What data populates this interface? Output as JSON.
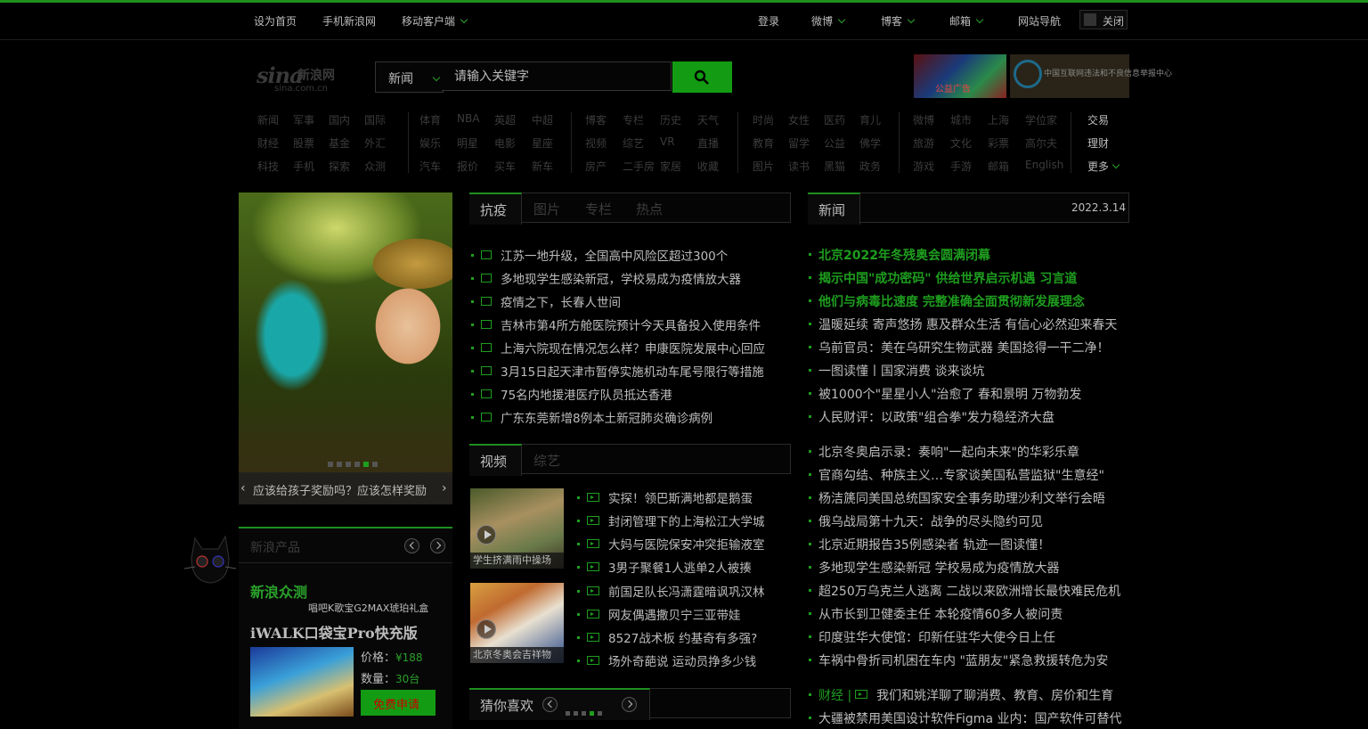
{
  "topbar": {
    "left": [
      "设为首页",
      "手机新浪网",
      "移动客户端"
    ],
    "right": [
      {
        "label": "登录",
        "dropdown": false
      },
      {
        "label": "微博",
        "dropdown": true
      },
      {
        "label": "博客",
        "dropdown": true
      },
      {
        "label": "邮箱",
        "dropdown": true
      },
      {
        "label": "网站导航",
        "dropdown": false
      }
    ],
    "close_label": "关闭"
  },
  "logo": {
    "mark": "sina",
    "cn": "新浪网",
    "domain": "sina.com.cn"
  },
  "search": {
    "category": "新闻",
    "placeholder": "请输入关键字"
  },
  "ads": {
    "ad1": "公益广告",
    "ad2": "中国互联网违法和不良信息举报中心"
  },
  "nav": [
    [
      [
        "新闻",
        "军事",
        "国内",
        "国际"
      ],
      [
        "财经",
        "股票",
        "基金",
        "外汇"
      ],
      [
        "科技",
        "手机",
        "探索",
        "众测"
      ]
    ],
    [
      [
        "体育",
        "NBA",
        "英超",
        "中超"
      ],
      [
        "娱乐",
        "明星",
        "电影",
        "星座"
      ],
      [
        "汽车",
        "报价",
        "买车",
        "新车"
      ]
    ],
    [
      [
        "博客",
        "专栏",
        "历史",
        "天气"
      ],
      [
        "视频",
        "综艺",
        "VR",
        "直播"
      ],
      [
        "房产",
        "二手房",
        "家居",
        "收藏"
      ]
    ],
    [
      [
        "时尚",
        "女性",
        "医药",
        "育儿"
      ],
      [
        "教育",
        "留学",
        "公益",
        "佛学"
      ],
      [
        "图片",
        "读书",
        "黑猫",
        "政务"
      ]
    ],
    [
      [
        "微博",
        "城市",
        "上海",
        "学位家"
      ],
      [
        "旅游",
        "文化",
        "彩票",
        "高尔夫"
      ],
      [
        "游戏",
        "手游",
        "邮箱",
        "English"
      ]
    ],
    [
      [
        "交易"
      ],
      [
        "理财"
      ],
      [
        "更多"
      ]
    ]
  ],
  "slide": {
    "caption": "应该给孩子奖励吗？应该怎样奖励",
    "dots": 6,
    "active_dot": 4
  },
  "products": {
    "title": "新浪产品",
    "brand": "新浪众测",
    "subtitle": "唱吧K歌宝G2MAX琥珀礼盒",
    "name": "iWALK口袋宝Pro快充版",
    "price_label": "价格：",
    "price": "¥188",
    "qty_label": "数量：",
    "qty": "30台",
    "apply": "免费申请"
  },
  "center": {
    "tabs": [
      "抗疫",
      "图片",
      "专栏",
      "热点"
    ],
    "news": [
      "江苏一地升级，全国高中风险区超过300个",
      "多地现学生感染新冠，学校易成为疫情放大器",
      "疫情之下，长春人世间",
      "吉林市第4所方舱医院预计今天具备投入使用条件",
      "上海六院现在情况怎么样？申康医院发展中心回应",
      "3月15日起天津市暂停实施机动车尾号限行等措施",
      "75名内地援港医疗队员抵达香港",
      "广东东莞新增8例本土新冠肺炎确诊病例"
    ],
    "video_tabs": [
      "视频",
      "综艺"
    ],
    "video_thumbs": [
      "学生挤满雨中操场",
      "北京冬奥会吉祥物"
    ],
    "video_news": [
      "实探！领巴斯满地都是鹅蛋",
      "封闭管理下的上海松江大学城",
      "大妈与医院保安冲突拒输液室",
      "3男子聚餐1人逃单2人被揍",
      "前国足队长冯潇霆暗讽巩汉林",
      "网友偶遇撒贝宁三亚带娃",
      "8527战术板 约基奇有多强?",
      "场外奇葩说 运动员挣多少钱"
    ],
    "like_label": "猜你喜欢",
    "like_dots": 5,
    "like_active": 3
  },
  "right": {
    "tab": "新闻",
    "date": "2022.3.14",
    "group1": [
      {
        "text": "北京2022年冬残奥会圆满闭幕",
        "style": "bold"
      },
      {
        "text": "揭示中国\"成功密码\" 供给世界启示机遇 习言道",
        "style": "bold"
      },
      {
        "text": "他们与病毒比速度 完整准确全面贯彻新发展理念",
        "style": "bold"
      },
      {
        "text": "温暖延续 寄声悠扬 惠及群众生活 有信心必然迎来春天",
        "style": "normal"
      },
      {
        "text": "乌前官员：美在乌研究生物武器 美国捻得一干二净！",
        "style": "normal"
      },
      {
        "text": "一图读懂丨国家消费 谈来谈坑",
        "style": "normal"
      },
      {
        "text": "被1000个\"星星小人\"治愈了 春和景明 万物勃发",
        "style": "normal"
      },
      {
        "text": "人民财评：以政策\"组合拳\"发力稳经济大盘",
        "style": "normal"
      }
    ],
    "group2": [
      "北京冬奥启示录：奏响\"一起向未来\"的华彩乐章",
      "官商勾结、种族主义…专家谈美国私营监狱\"生意经\"",
      "杨洁篪同美国总统国家安全事务助理沙利文举行会晤",
      "俄乌战局第十九天：战争的尽头隐约可见",
      "北京近期报告35例感染者 轨迹一图读懂！",
      "多地现学生感染新冠 学校易成为疫情放大器",
      "超250万乌克兰人逃离 二战以来欧洲增长最快难民危机",
      "从市长到卫健委主任 本轮疫情60多人被问责",
      "印度驻华大使馆：印新任驻华大使今日上任",
      "车祸中骨折司机困在车内 \"蓝朋友\"紧急救援转危为安"
    ],
    "group3_prefix": "财经 |",
    "group3": [
      "我们和姚洋聊了聊消费、教育、房价和生育",
      "大疆被禁用美国设计软件Figma 业内：国产软件可替代"
    ]
  }
}
